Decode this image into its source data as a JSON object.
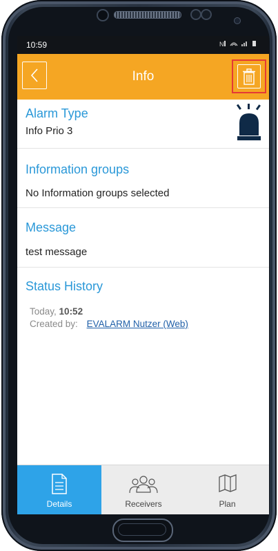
{
  "status_bar": {
    "time": "10:59",
    "indicators": "N͈ ≡ .∥ ▮"
  },
  "app_bar": {
    "title": "Info",
    "back_icon": "chevron-left-icon",
    "delete_icon": "trash-icon",
    "accent": "#f5a623",
    "highlight": "#e53935"
  },
  "sections": {
    "alarm_type": {
      "title": "Alarm Type",
      "value": "Info Prio 3",
      "icon": "siren-icon"
    },
    "info_groups": {
      "title": "Information groups",
      "value": "No Information groups selected"
    },
    "message": {
      "title": "Message",
      "value": "test message"
    },
    "status_history": {
      "title": "Status History",
      "day": "Today,",
      "time": "10:52",
      "created_by_label": "Created by:",
      "created_by_user": "EVALARM Nutzer (Web)"
    }
  },
  "tabs": [
    {
      "label": "Details",
      "icon": "document-icon",
      "active": true
    },
    {
      "label": "Receivers",
      "icon": "group-icon",
      "active": false
    },
    {
      "label": "Plan",
      "icon": "map-icon",
      "active": false
    }
  ],
  "colors": {
    "title_blue": "#2a98d8",
    "tab_active": "#2ea3e8",
    "link": "#1f5fa8"
  }
}
